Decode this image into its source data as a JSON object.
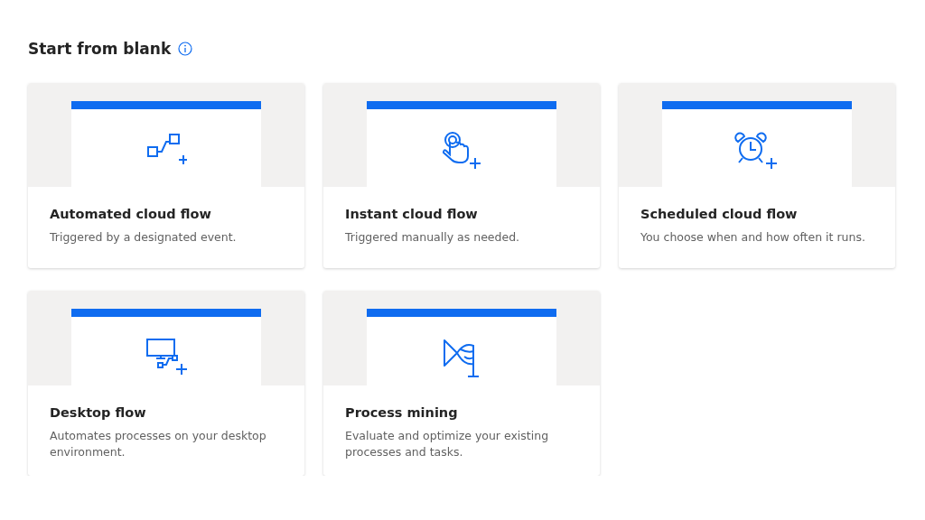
{
  "section": {
    "title": "Start from blank"
  },
  "cards": [
    {
      "kind": "automated",
      "title": "Automated cloud flow",
      "description": "Triggered by a designated event."
    },
    {
      "kind": "instant",
      "title": "Instant cloud flow",
      "description": "Triggered manually as needed."
    },
    {
      "kind": "scheduled",
      "title": "Scheduled cloud flow",
      "description": "You choose when and how often it runs."
    },
    {
      "kind": "desktop",
      "title": "Desktop flow",
      "description": "Automates processes on your desktop environment."
    },
    {
      "kind": "mining",
      "title": "Process mining",
      "description": "Evaluate and optimize your existing processes and tasks."
    }
  ]
}
